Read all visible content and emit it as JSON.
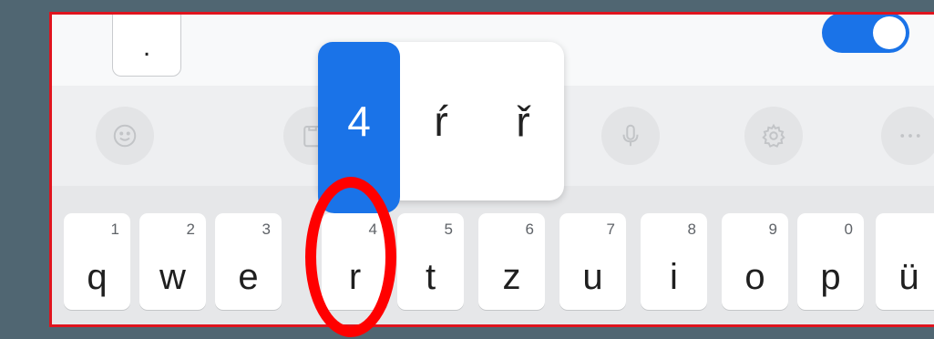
{
  "period_key": ".",
  "toolbar": {
    "buttons": [
      {
        "name": "emoji-icon"
      },
      {
        "name": "clipboard-icon"
      },
      {
        "name": "keyboard-icon"
      },
      {
        "name": "microphone-icon"
      },
      {
        "name": "settings-icon"
      },
      {
        "name": "more-icon"
      }
    ]
  },
  "popup": {
    "options": [
      "4",
      "ŕ",
      "ř"
    ],
    "selected_index": 0
  },
  "keys": [
    {
      "label": "q",
      "hint": "1"
    },
    {
      "label": "w",
      "hint": "2"
    },
    {
      "label": "e",
      "hint": "3"
    },
    {
      "label": "r",
      "hint": "4"
    },
    {
      "label": "t",
      "hint": "5"
    },
    {
      "label": "z",
      "hint": "6"
    },
    {
      "label": "u",
      "hint": "7"
    },
    {
      "label": "i",
      "hint": "8"
    },
    {
      "label": "o",
      "hint": "9"
    },
    {
      "label": "p",
      "hint": "0"
    },
    {
      "label": "ü",
      "hint": ""
    }
  ],
  "colors": {
    "background": "#506672",
    "accent": "#1a73e8",
    "annotation": "#ff0000"
  },
  "toggle": {
    "state": "on"
  }
}
